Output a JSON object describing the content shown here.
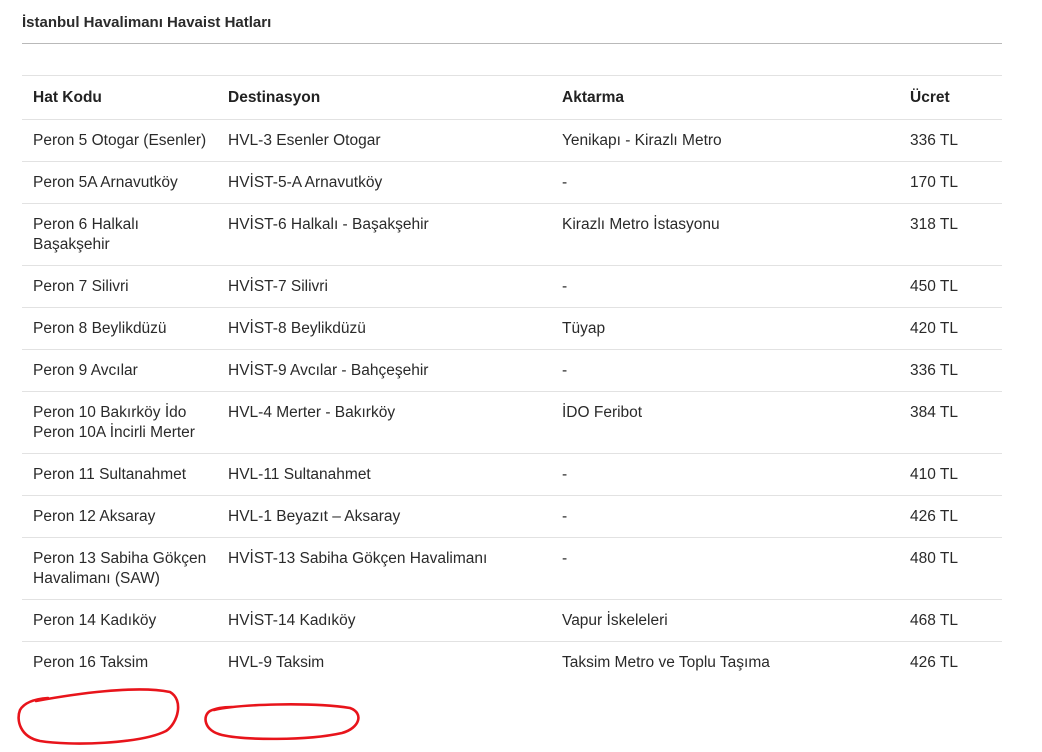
{
  "section": {
    "title": "İstanbul Havalimanı Havaist Hatları"
  },
  "table": {
    "headers": {
      "hat_kodu": "Hat Kodu",
      "destinasyon": "Destinasyon",
      "aktarma": "Aktarma",
      "ucret": "Ücret"
    },
    "rows": [
      {
        "hat": "Peron 5 Otogar (Esenler)",
        "dest": "HVL-3 Esenler Otogar",
        "aktarma": "Yenikapı - Kirazlı Metro",
        "ucret": "336 TL"
      },
      {
        "hat": "Peron 5A Arnavutköy",
        "dest": "HVİST-5-A Arnavutköy",
        "aktarma": "-",
        "ucret": "170 TL"
      },
      {
        "hat": "Peron 6 Halkalı Başakşehir",
        "dest": "HVİST-6 Halkalı - Başakşehir",
        "aktarma": "Kirazlı Metro İstasyonu",
        "ucret": "318 TL"
      },
      {
        "hat": "Peron 7 Silivri",
        "dest": "HVİST-7 Silivri",
        "aktarma": "-",
        "ucret": "450 TL"
      },
      {
        "hat": "Peron 8 Beylikdüzü",
        "dest": "HVİST-8 Beylikdüzü",
        "aktarma": "Tüyap",
        "ucret": "420 TL"
      },
      {
        "hat": "Peron 9 Avcılar",
        "dest": "HVİST-9 Avcılar - Bahçeşehir",
        "aktarma": "-",
        "ucret": "336 TL"
      },
      {
        "hat": "Peron 10 Bakırköy İdo Peron 10A İncirli Merter",
        "dest": "HVL-4 Merter - Bakırköy",
        "aktarma": "İDO Feribot",
        "ucret": "384 TL"
      },
      {
        "hat": "Peron 11 Sultanahmet",
        "dest": "HVL-11 Sultanahmet",
        "aktarma": "-",
        "ucret": "410 TL"
      },
      {
        "hat": "Peron 12 Aksaray",
        "dest": "HVL-1 Beyazıt – Aksaray",
        "aktarma": "-",
        "ucret": "426 TL"
      },
      {
        "hat": "Peron 13 Sabiha Gökçen Havalimanı (SAW)",
        "dest": "HVİST-13 Sabiha Gökçen Havalimanı",
        "aktarma": "-",
        "ucret": "480 TL"
      },
      {
        "hat": "Peron 14 Kadıköy",
        "dest": "HVİST-14 Kadıköy",
        "aktarma": "Vapur İskeleleri",
        "ucret": "468 TL"
      },
      {
        "hat": "Peron 16 Taksim",
        "dest": "HVL-9 Taksim",
        "aktarma": "Taksim Metro ve Toplu Taşıma",
        "ucret": "426 TL"
      }
    ]
  },
  "annotation": {
    "stroke_color": "#e8141b"
  }
}
